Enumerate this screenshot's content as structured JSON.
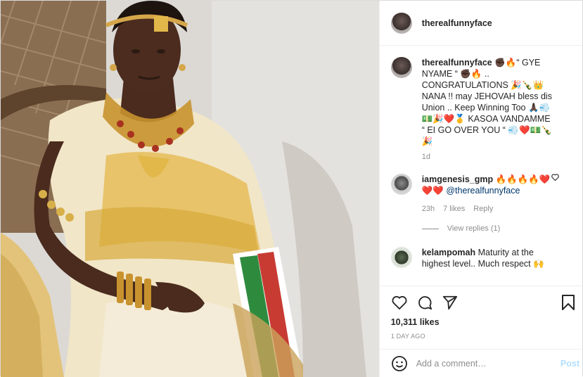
{
  "post": {
    "username": "therealfunnyface",
    "caption_text": "✊🏿🔥“ GYE NYAME “ ✊🏿🔥 .. CONGRATULATIONS 🎉🍾👑 NANA !! may JEHOVAH bless dis Union .. Keep Winning Too 🙏🏿💨💵🎉❤️🥇 KASOA VANDAMME “ EI GO OVER YOU “ 💨❤️💵🍾🎉",
    "caption_age": "1d",
    "likes": "10,311 likes",
    "timestamp": "1 DAY AGO"
  },
  "comments": [
    {
      "username": "iamgenesis_gmp",
      "text": "🔥🔥🔥🔥❤️ ❤️❤️",
      "mention": "@therealfunnyface",
      "age": "23h",
      "likes": "7 likes",
      "reply": "Reply",
      "view_replies": "View replies (1)"
    },
    {
      "username": "kelampomah",
      "text": "Maturity at the highest level.. Much respect 🙌"
    }
  ],
  "add_comment": {
    "placeholder": "Add a comment…",
    "post_label": "Post"
  },
  "icons": [
    "like-icon",
    "comment-icon",
    "share-icon",
    "save-icon",
    "emoji-icon"
  ]
}
